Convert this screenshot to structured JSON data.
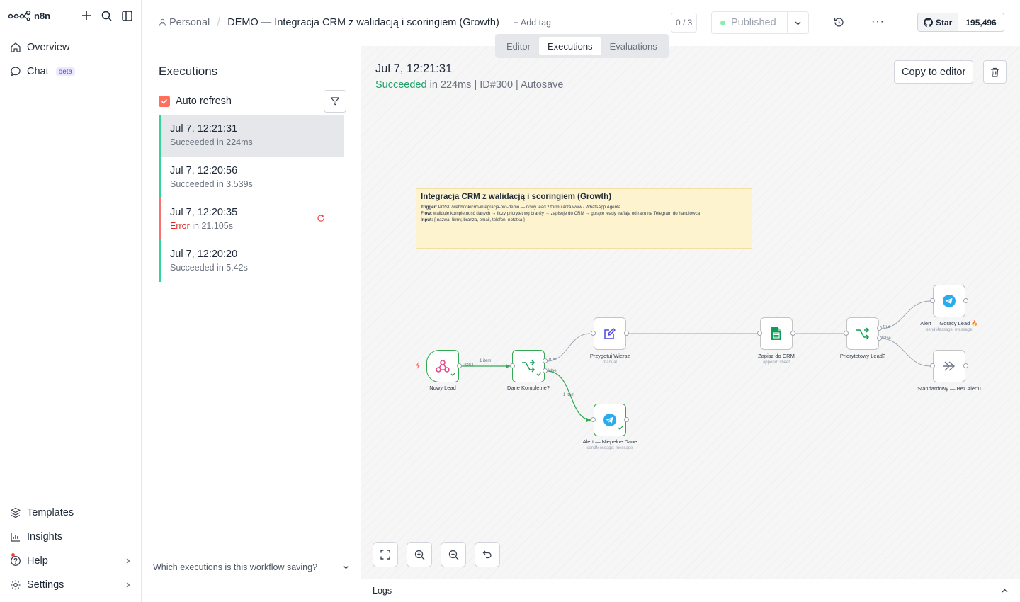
{
  "app": {
    "logo_text": "n8n"
  },
  "sidebar": {
    "items": [
      {
        "label": "Overview",
        "icon": "home-icon"
      },
      {
        "label": "Chat",
        "badge": "beta",
        "icon": "chat-icon"
      }
    ],
    "bottom": [
      {
        "label": "Templates",
        "icon": "templates-icon"
      },
      {
        "label": "Insights",
        "icon": "insights-icon"
      },
      {
        "label": "Help",
        "icon": "help-icon"
      },
      {
        "label": "Settings",
        "icon": "gear-icon"
      }
    ]
  },
  "header": {
    "project": "Personal",
    "separator": "/",
    "workflow_name": "DEMO — Integracja CRM z walidacją i scoringiem (Growth)",
    "add_tag": "+ Add tag",
    "counter": "0 / 3",
    "published": "Published",
    "more": "···",
    "github": {
      "star": "Star",
      "count": "195,496"
    }
  },
  "tabs": [
    {
      "label": "Editor",
      "active": false
    },
    {
      "label": "Executions",
      "active": true
    },
    {
      "label": "Evaluations",
      "active": false
    }
  ],
  "executions": {
    "title": "Executions",
    "auto_refresh": "Auto refresh",
    "items": [
      {
        "time": "Jul 7, 12:21:31",
        "status": "Succeeded",
        "duration": " in 224ms",
        "selected": true
      },
      {
        "time": "Jul 7, 12:20:56",
        "status": "Succeeded",
        "duration": " in 3.539s"
      },
      {
        "time": "Jul 7, 12:20:35",
        "status": "Error",
        "duration": " in 21.105s"
      },
      {
        "time": "Jul 7, 12:20:20",
        "status": "Succeeded",
        "duration": " in 5.42s"
      }
    ],
    "footer": "Which executions is this workflow saving?"
  },
  "detail": {
    "date": "Jul 7, 12:21:31",
    "status": "Succeeded",
    "meta_rest": " in 224ms | ID#300 | Autosave",
    "copy_button": "Copy to editor"
  },
  "sticky": {
    "title": "Integracja CRM z walidacją i scoringiem (Growth)",
    "trigger_label": "Trigger:",
    "trigger": " POST /webhook/crm-integracja-pro-demo — nowy lead z formularza www / WhatsApp Agenta",
    "flow_label": "Flow:",
    "flow": " waliduje kompletność danych → liczy priorytet wg branży → zapisuje do CRM → gorące leady trafiają od razu na Telegram do handlowca",
    "input_label": "Input:",
    "input": " { nazwa_firmy, branza, email, telefon, notatka }"
  },
  "nodes": {
    "webhook": {
      "label": "Nowy Lead",
      "icon": "webhook-icon",
      "port": "POST"
    },
    "if1": {
      "label": "Dane Kompletne?",
      "icon": "if-branch-icon",
      "true": "true",
      "false": "false"
    },
    "set": {
      "label": "Przygotuj Wiersz",
      "sub": "manual",
      "icon": "edit-icon"
    },
    "sheets": {
      "label": "Zapisz do CRM",
      "sub": "append: sheet",
      "icon": "google-sheets-icon"
    },
    "if2": {
      "label": "Priorytetowy Lead?",
      "icon": "if-branch-icon",
      "true": "true",
      "false": "false"
    },
    "tg_hot": {
      "label": "Alert — Gorący Lead 🔥",
      "sub": "sendMessage: message",
      "icon": "telegram-icon"
    },
    "noop": {
      "label": "Standardowy — Bez Alertu",
      "icon": "noop-arrow-icon"
    },
    "tg_incomplete": {
      "label": "Alert — Niepełne Dane",
      "sub": "sendMessage: message",
      "icon": "telegram-icon"
    }
  },
  "edges": {
    "item1": "1 item",
    "item2": "1 item"
  },
  "logs": "Logs",
  "colors": {
    "accent": "#ff6f5c",
    "success": "#22a06b",
    "error": "#dc2626",
    "sticky": "#fdf3cf"
  }
}
